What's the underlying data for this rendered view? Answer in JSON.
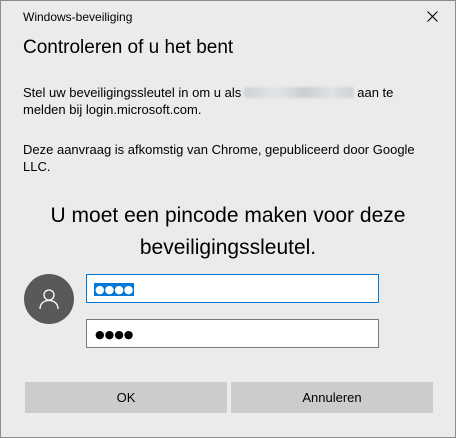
{
  "window": {
    "title": "Windows-beveiliging",
    "close_icon": "close-icon"
  },
  "dialog": {
    "heading": "Controleren of u het bent",
    "intro_before": "Stel uw beveiligingssleutel in om u als",
    "intro_after": "aan te melden bij login.microsoft.com.",
    "source": "Deze aanvraag is afkomstig van Chrome, gepubliceerd door Google LLC.",
    "prompt": "U moet een pincode maken voor deze beveiligingssleutel."
  },
  "pin": {
    "new_value": "●●●●",
    "confirm_value": "●●●●",
    "avatar_icon": "user-icon"
  },
  "buttons": {
    "ok": "OK",
    "cancel": "Annuleren"
  }
}
